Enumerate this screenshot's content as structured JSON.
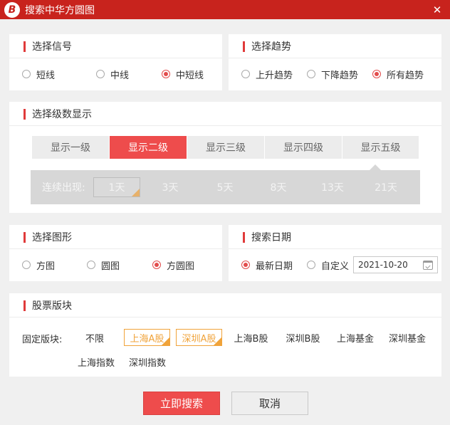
{
  "window": {
    "title": "搜索中华方圆图",
    "logo_letter": "B",
    "close_glyph": "✕"
  },
  "signal": {
    "title": "选择信号",
    "options": [
      {
        "label": "短线",
        "checked": false
      },
      {
        "label": "中线",
        "checked": false
      },
      {
        "label": "中短线",
        "checked": true
      }
    ]
  },
  "trend": {
    "title": "选择趋势",
    "options": [
      {
        "label": "上升趋势",
        "checked": false
      },
      {
        "label": "下降趋势",
        "checked": false
      },
      {
        "label": "所有趋势",
        "checked": true
      }
    ]
  },
  "levels": {
    "title": "选择级数显示",
    "tabs": [
      {
        "label": "显示一级",
        "active": false
      },
      {
        "label": "显示二级",
        "active": true
      },
      {
        "label": "显示三级",
        "active": false
      },
      {
        "label": "显示四级",
        "active": false
      },
      {
        "label": "显示五级",
        "active": false
      }
    ],
    "continuous_label": "连续出现:",
    "days": [
      {
        "label": "1天",
        "selected": true
      },
      {
        "label": "3天",
        "selected": false
      },
      {
        "label": "5天",
        "selected": false
      },
      {
        "label": "8天",
        "selected": false
      },
      {
        "label": "13天",
        "selected": false
      },
      {
        "label": "21天",
        "selected": false
      }
    ]
  },
  "shape": {
    "title": "选择图形",
    "options": [
      {
        "label": "方图",
        "checked": false
      },
      {
        "label": "圆图",
        "checked": false
      },
      {
        "label": "方圆图",
        "checked": true
      }
    ]
  },
  "date": {
    "title": "搜索日期",
    "options": [
      {
        "label": "最新日期",
        "checked": true
      },
      {
        "label": "自定义",
        "checked": false
      }
    ],
    "value": "2021-10-20"
  },
  "board": {
    "title": "股票版块",
    "fixed_label": "固定版块:",
    "chips": [
      {
        "label": "不限",
        "active": false
      },
      {
        "label": "上海A股",
        "active": true
      },
      {
        "label": "深圳A股",
        "active": true
      },
      {
        "label": "上海B股",
        "active": false
      },
      {
        "label": "深圳B股",
        "active": false
      },
      {
        "label": "上海基金",
        "active": false
      },
      {
        "label": "深圳基金",
        "active": false
      },
      {
        "label": "上海指数",
        "active": false
      },
      {
        "label": "深圳指数",
        "active": false
      }
    ]
  },
  "actions": {
    "search_label": "立即搜索",
    "cancel_label": "取消"
  },
  "colors": {
    "accent": "#ee4c4c",
    "titlebar": "#c8231d",
    "chip_active": "#f0a33a"
  }
}
